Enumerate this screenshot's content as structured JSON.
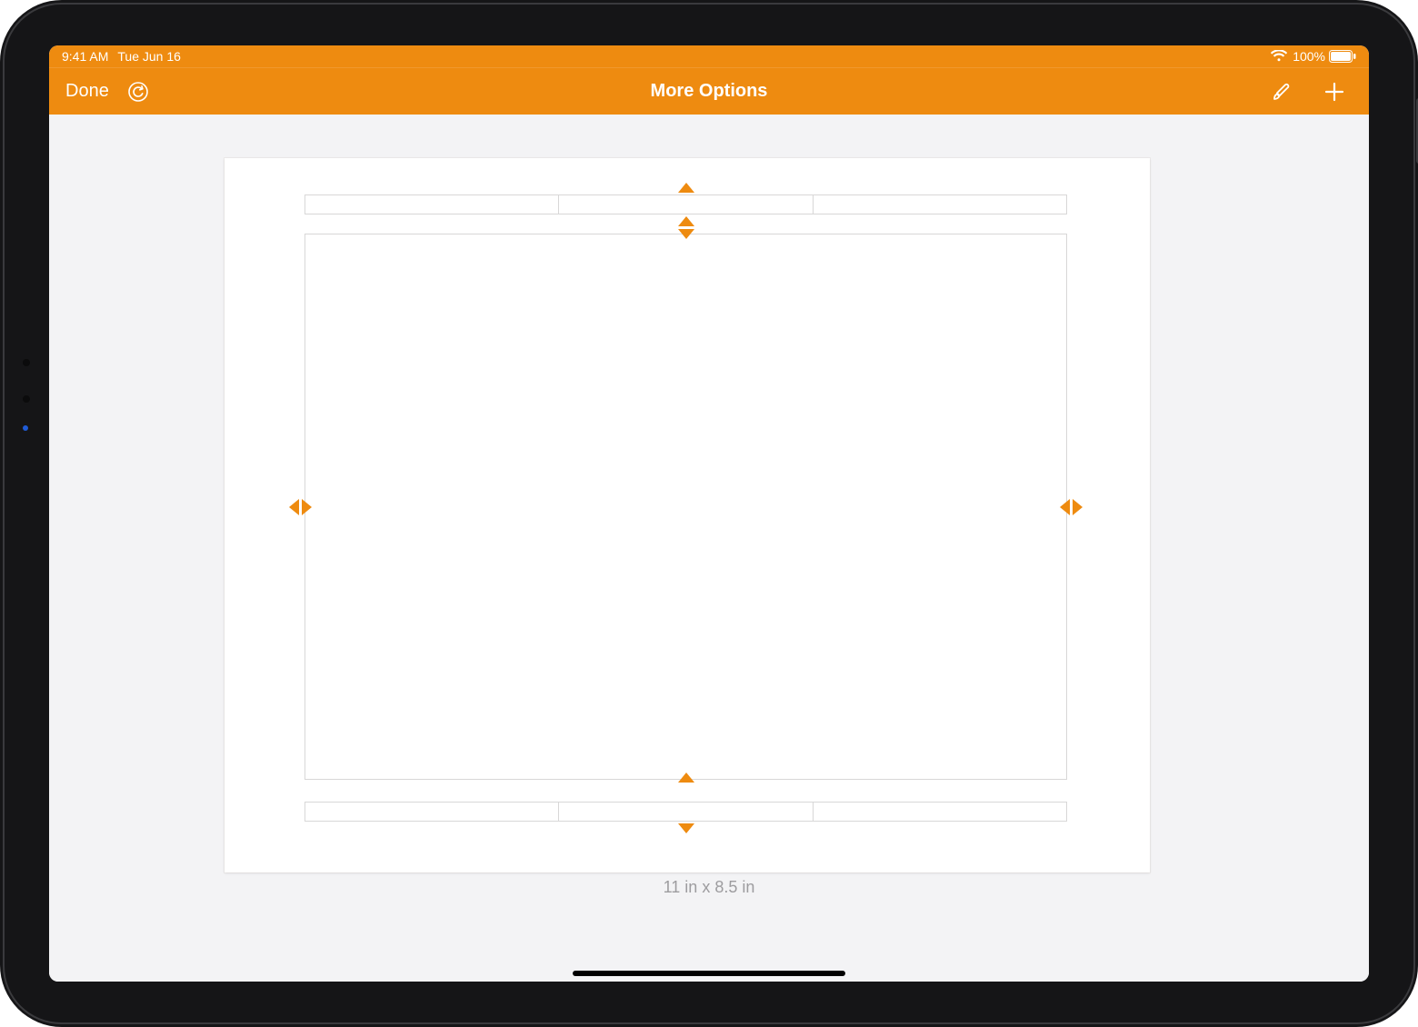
{
  "status": {
    "time": "9:41 AM",
    "date": "Tue Jun 16",
    "battery_pct": "100%"
  },
  "toolbar": {
    "done_label": "Done",
    "title": "More Options"
  },
  "page": {
    "size_label": "11 in x 8.5 in"
  },
  "colors": {
    "accent": "#ee8b10"
  }
}
